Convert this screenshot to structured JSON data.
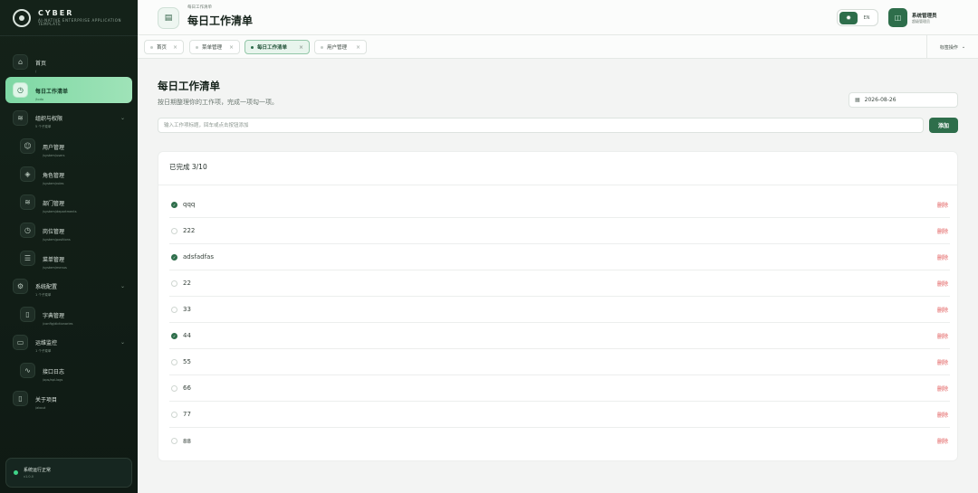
{
  "brand": {
    "title": "CYBER",
    "subtitle": "AI-NATIVE ENTERPRISE APPLICATION TEMPLATE"
  },
  "sidebar": {
    "items": [
      {
        "label": "首页",
        "sub": "/"
      },
      {
        "label": "每日工作清单",
        "sub": "/todo"
      },
      {
        "label": "组织与权限",
        "sub": "5 个子菜单"
      },
      {
        "label": "用户管理",
        "sub": "/system/users"
      },
      {
        "label": "角色管理",
        "sub": "/system/roles"
      },
      {
        "label": "部门管理",
        "sub": "/system/departments"
      },
      {
        "label": "岗位管理",
        "sub": "/system/positions"
      },
      {
        "label": "菜单管理",
        "sub": "/system/menus"
      },
      {
        "label": "系统配置",
        "sub": "1 个子菜单"
      },
      {
        "label": "字典管理",
        "sub": "/config/dictionaries"
      },
      {
        "label": "运维监控",
        "sub": "1 个子菜单"
      },
      {
        "label": "接口日志",
        "sub": "/ops/api-logs"
      },
      {
        "label": "关于项目",
        "sub": "/about"
      }
    ],
    "status": {
      "title": "系统运行正常",
      "sub": "v1.0.0"
    }
  },
  "header": {
    "breadcrumb": "每日工作清单",
    "title": "每日工作清单",
    "theme_off_label": "EN",
    "user_name": "系统管理员",
    "user_role": "超级管理员"
  },
  "tabs": [
    {
      "label": "首页",
      "active": false
    },
    {
      "label": "菜单管理",
      "active": false
    },
    {
      "label": "每日工作清单",
      "active": true
    },
    {
      "label": "用户管理",
      "active": false
    }
  ],
  "tab_ops_label": "标签操作",
  "main": {
    "title": "每日工作清单",
    "description": "按日期整理你的工作项，完成一项勾一项。",
    "date": "2026-08-26",
    "input_placeholder": "输入工作项标题，回车或点击按钮添加",
    "add_label": "添加",
    "progress_label": "已完成 3/10",
    "delete_label": "删除",
    "tasks": [
      {
        "title": "qqq",
        "done": true
      },
      {
        "title": "222",
        "done": false
      },
      {
        "title": "adsfadfas",
        "done": true
      },
      {
        "title": "22",
        "done": false
      },
      {
        "title": "33",
        "done": false
      },
      {
        "title": "44",
        "done": true
      },
      {
        "title": "55",
        "done": false
      },
      {
        "title": "66",
        "done": false
      },
      {
        "title": "77",
        "done": false
      },
      {
        "title": "88",
        "done": false
      }
    ]
  },
  "colors": {
    "accent": "#2e6e4b",
    "active_menu": "#8fdeb0",
    "danger": "#e05555",
    "sidebar_bg": "#132019"
  }
}
